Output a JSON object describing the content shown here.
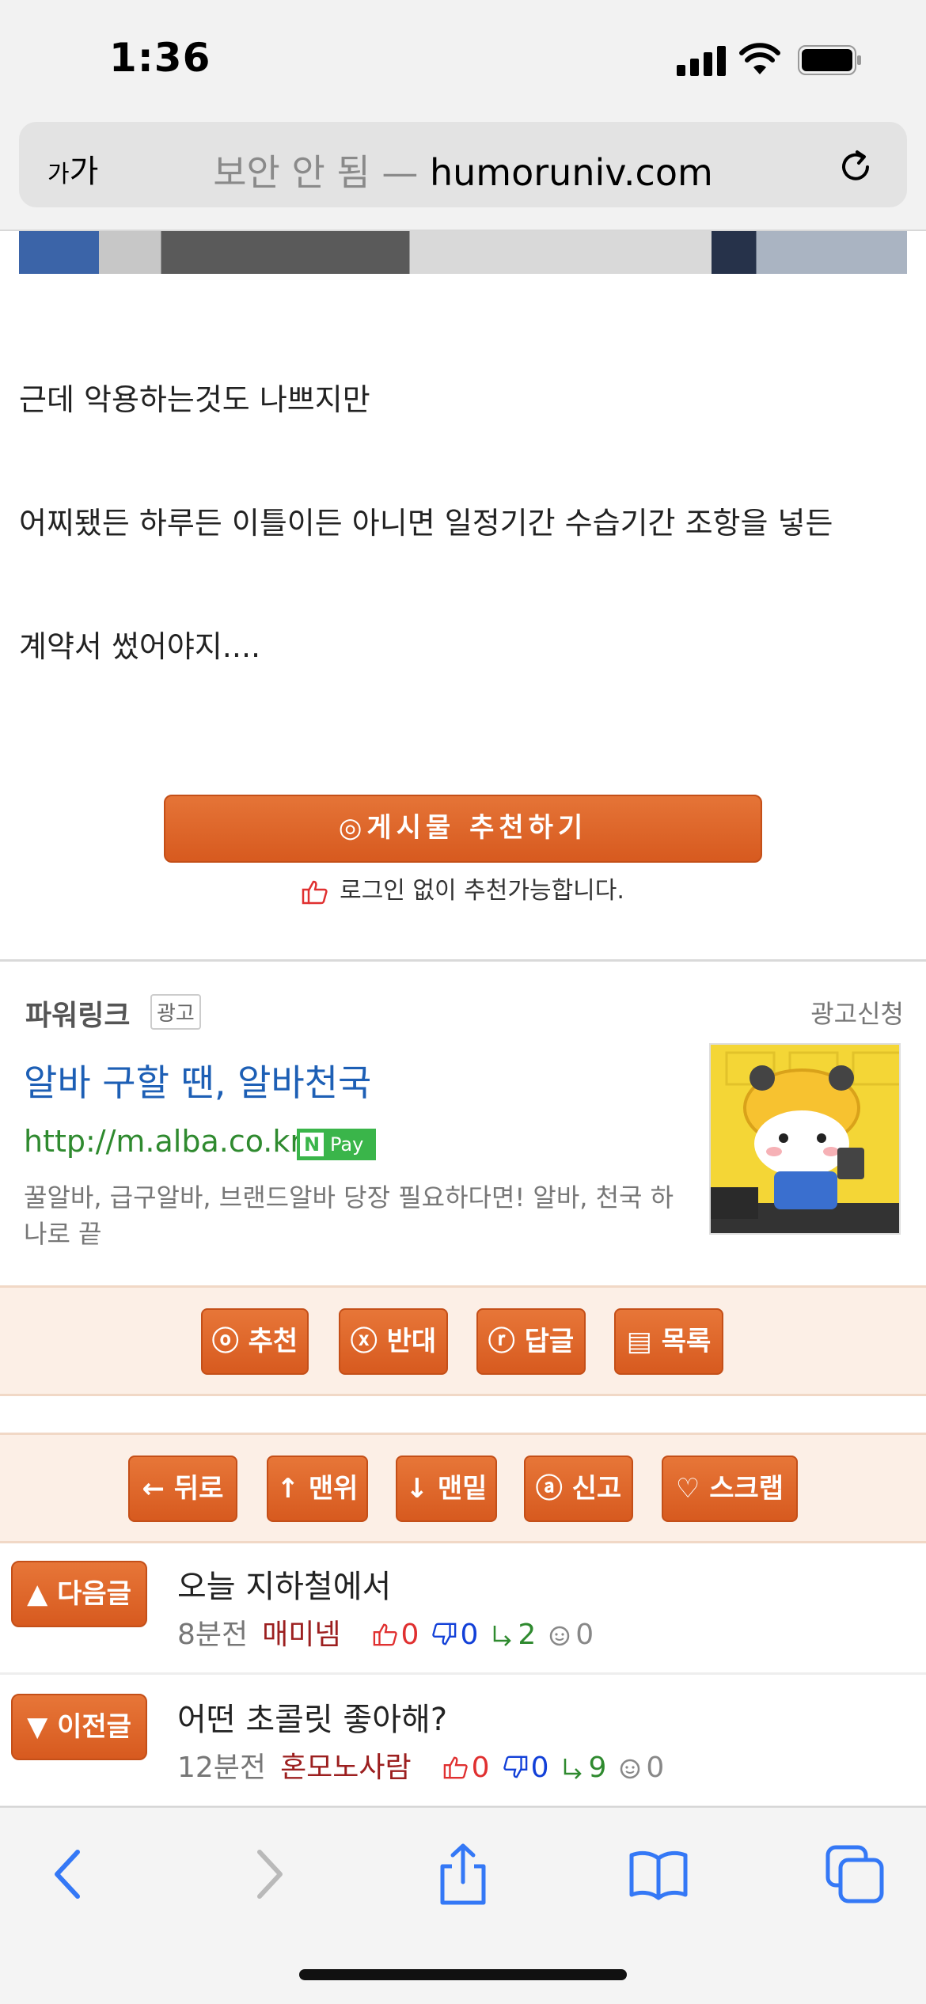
{
  "status_bar": {
    "time": "1:36"
  },
  "browser": {
    "aa_small": "가",
    "aa_large": "가",
    "insecure_label": "보안 안 됨 —",
    "domain": "humoruniv.com"
  },
  "article": {
    "lines": [
      "근데 악용하는것도 나쁘지만",
      "어찌됐든 하루든 이틀이든 아니면 일정기간 수습기간 조항을 넣든",
      "계약서 썼어야지...."
    ]
  },
  "recommend": {
    "button_label": "◎게시물  추천하기",
    "note": "로그인 없이 추천가능합니다."
  },
  "powerlink": {
    "title": "파워링크",
    "badge": "광고",
    "apply": "광고신청",
    "ad_title": "알바 구할 땐, 알바천국",
    "ad_url": "http://m.alba.co.kr",
    "npay_n": "N",
    "npay_text": "Pay",
    "ad_desc": "꿀알바, 급구알바, 브랜드알바 당장 필요하다면! 알바, 천국 하나로 끝"
  },
  "action_bar": [
    {
      "label": "ⓞ 추천"
    },
    {
      "label": "ⓧ 반대"
    },
    {
      "label": "ⓡ 답글"
    },
    {
      "label": "▤ 목록"
    }
  ],
  "nav_bar": [
    {
      "label": "← 뒤로"
    },
    {
      "label": "↑ 맨위"
    },
    {
      "label": "↓ 맨밑"
    },
    {
      "label": "ⓐ 신고"
    },
    {
      "label": "♡ 스크랩"
    }
  ],
  "next_post": {
    "button": "▲ 다음글",
    "title": "오늘 지하철에서",
    "time": "8분전",
    "author": "매미넴",
    "up": "0",
    "down": "0",
    "replies": "2",
    "views": "0"
  },
  "prev_post": {
    "button": "▼ 이전글",
    "title": "어떤 초콜릿 좋아해?",
    "time": "12분전",
    "author": "혼모노사람",
    "up": "0",
    "down": "0",
    "replies": "9",
    "views": "0"
  },
  "colors": {
    "accent_orange": "#d75a1f",
    "link_blue": "#1d5fb5",
    "url_green": "#2f8a2f",
    "ios_blue": "#3478f6"
  }
}
